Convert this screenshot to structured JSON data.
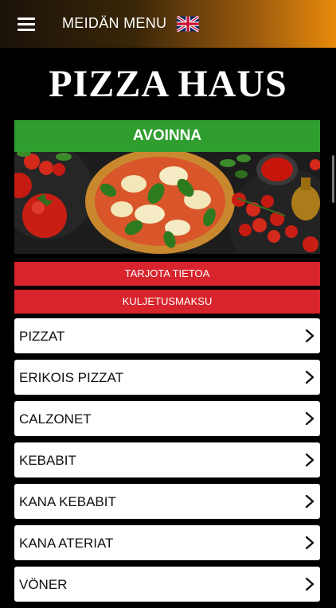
{
  "header": {
    "title": "MEIDÄN MENU"
  },
  "brand": {
    "name": "PIZZA HAUS"
  },
  "status": {
    "label": "AVOINNA"
  },
  "info_buttons": [
    {
      "label": "TARJOTA TIETOA"
    },
    {
      "label": "KULJETUSMAKSU"
    }
  ],
  "menu": {
    "items": [
      {
        "label": "PIZZAT"
      },
      {
        "label": "ERIKOIS PIZZAT"
      },
      {
        "label": "CALZONET"
      },
      {
        "label": "KEBABIT"
      },
      {
        "label": "KANA KEBABIT"
      },
      {
        "label": "KANA ATERIAT"
      },
      {
        "label": "VÖNER"
      }
    ]
  },
  "colors": {
    "accent_green": "#2f9e2f",
    "accent_red": "#d8242c",
    "header_gradient_end": "#e88a0c"
  },
  "icons": [
    "hamburger-icon",
    "uk-flag-icon",
    "chevron-right-icon"
  ]
}
